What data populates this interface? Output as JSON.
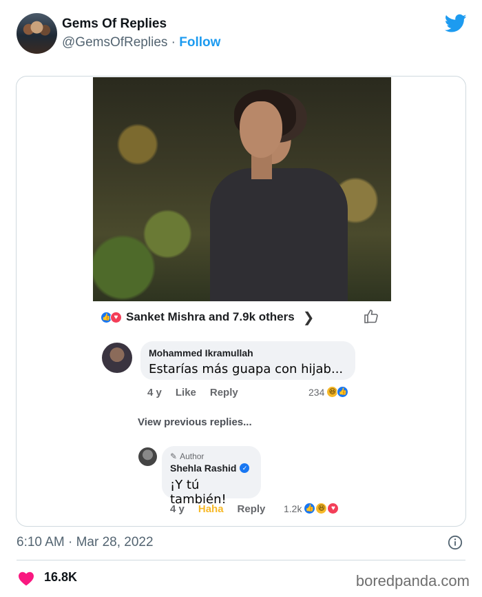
{
  "tweet": {
    "display_name": "Gems Of Replies",
    "handle": "@GemsOfReplies",
    "separator": " · ",
    "follow_label": "Follow",
    "timestamp": "6:10 AM · Mar 28, 2022",
    "likes_count": "16.8K",
    "brand_color": "#1d9bf0",
    "like_color": "#f91880"
  },
  "facebook_post": {
    "reactions_summary": "Sanket Mishra and 7.9k others",
    "reaction_icons": [
      "like-icon",
      "love-icon"
    ],
    "comments": [
      {
        "author": "Mohammed Ikramullah",
        "text": "Estarías más guapa con hijab...",
        "time": "4 y",
        "like_label": "Like",
        "reply_label": "Reply",
        "reaction_count": "234",
        "reaction_icons": [
          "haha-icon",
          "like-icon"
        ]
      }
    ],
    "view_previous_replies": "View previous replies...",
    "reply": {
      "author_tag": "Author",
      "author": "Shehla Rashid",
      "verified": true,
      "text": "¡Y tú también!",
      "time": "4 y",
      "haha_label": "Haha",
      "reply_label": "Reply",
      "reaction_count": "1.2k",
      "reaction_icons": [
        "like-icon",
        "haha-icon",
        "love-icon"
      ]
    }
  },
  "watermark": "boredpanda.com"
}
